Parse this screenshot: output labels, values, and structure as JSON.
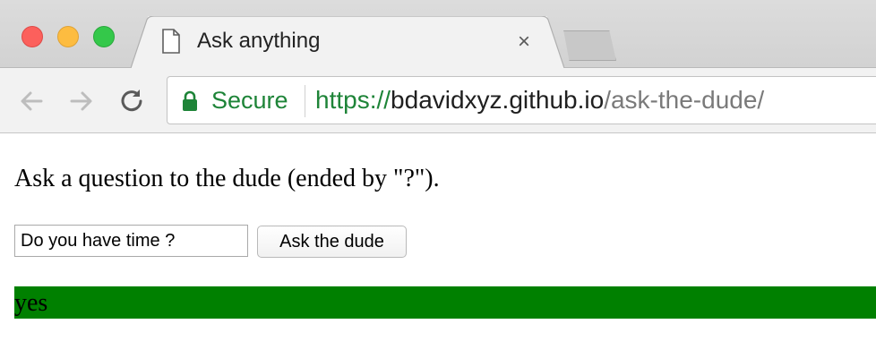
{
  "browser": {
    "tab": {
      "title": "Ask anything",
      "close_glyph": "×",
      "icon": "document-icon"
    },
    "address_bar": {
      "secure_label": "Secure",
      "url_scheme": "https",
      "url_separator": "://",
      "url_host": "bdavidxyz.github.io",
      "url_path": "/ask-the-dude/"
    },
    "colors": {
      "secure_green": "#1e8438",
      "answer_bg": "#008000"
    }
  },
  "page": {
    "question_prompt": "Ask a question to the dude (ended by \"?\").",
    "input_value": "Do you have time ?",
    "ask_button_label": "Ask the dude",
    "answer_text": "yes"
  }
}
